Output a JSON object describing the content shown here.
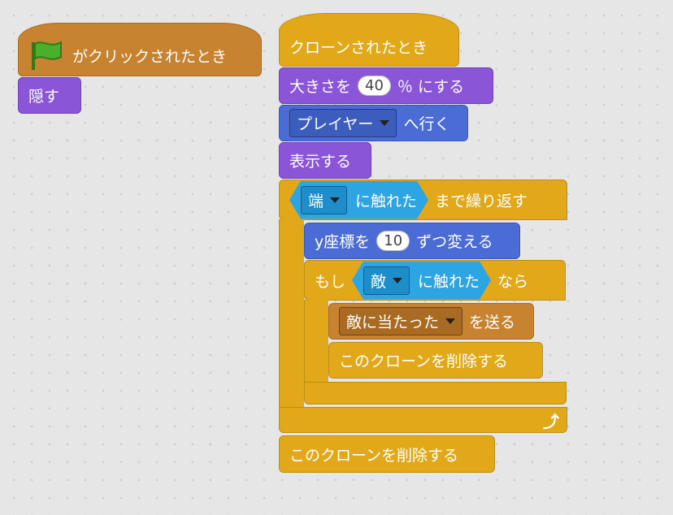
{
  "script1": {
    "flag_hat": {
      "icon": "green-flag-icon",
      "label": "がクリックされたとき"
    },
    "hide": {
      "label": "隠す"
    }
  },
  "script2": {
    "clone_hat": {
      "label": "クローンされたとき"
    },
    "set_size": {
      "before": "大きさを",
      "value": "40",
      "after": "％ にする"
    },
    "goto": {
      "target": "プレイヤー",
      "after": "へ行く"
    },
    "show": {
      "label": "表示する"
    },
    "repeat_until": {
      "cond_target": "端",
      "cond_label": "に触れた",
      "after": "まで繰り返す"
    },
    "change_y": {
      "before": "y座標を",
      "value": "10",
      "after": "ずつ変える"
    },
    "if_block": {
      "before": "もし",
      "cond_target": "敵",
      "cond_label": "に触れた",
      "after": "なら"
    },
    "broadcast": {
      "message": "敵に当たった",
      "after": "を送る"
    },
    "delete_inner": {
      "label": "このクローンを削除する"
    },
    "delete_final": {
      "label": "このクローンを削除する"
    }
  },
  "colors": {
    "events": "#c88330",
    "control": "#e1a91a",
    "looks": "#8a55d7",
    "motion": "#4a6cd4",
    "sensing": "#2ca5e2",
    "flag": "#4caf2a"
  }
}
